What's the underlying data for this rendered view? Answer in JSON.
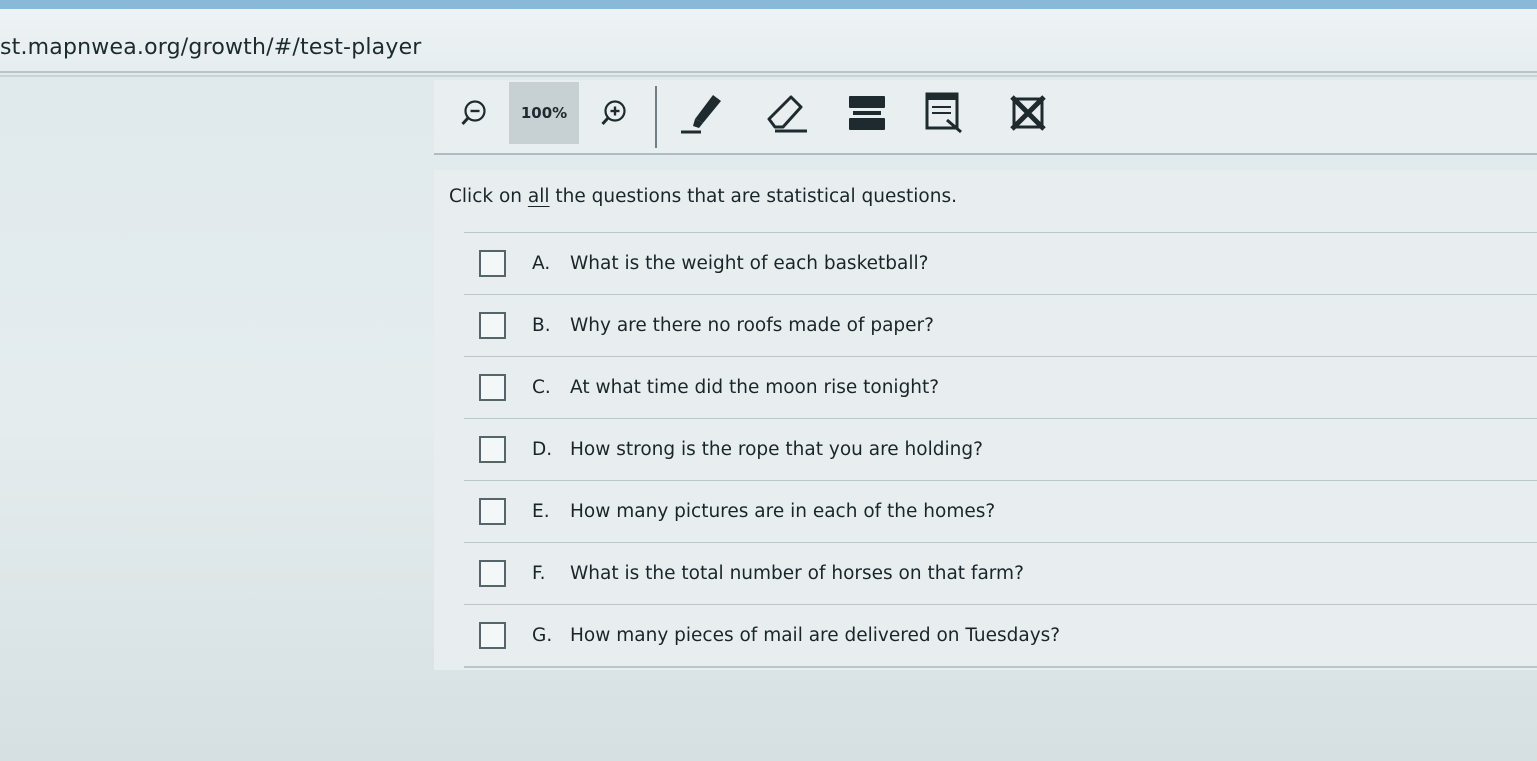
{
  "browser": {
    "url": "st.mapnwea.org/growth/#/test-player"
  },
  "toolbar": {
    "zoom_out_icon": "zoom-out-icon",
    "zoom_level": "100%",
    "zoom_in_icon": "zoom-in-icon",
    "tools": [
      "highlighter-icon",
      "eraser-icon",
      "line-reader-icon",
      "notepad-icon",
      "answer-eliminator-icon"
    ]
  },
  "question": {
    "prompt_before": "Click on ",
    "prompt_emphasis": "all",
    "prompt_after": " the questions that are statistical questions.",
    "choices": [
      {
        "letter": "A.",
        "text": "What is the weight of each basketball?"
      },
      {
        "letter": "B.",
        "text": "Why are there no roofs made of paper?"
      },
      {
        "letter": "C.",
        "text": "At what time did the moon rise tonight?"
      },
      {
        "letter": "D.",
        "text": "How strong is the rope that you are holding?"
      },
      {
        "letter": "E.",
        "text": "How many pictures are in each of the homes?"
      },
      {
        "letter": "F.",
        "text": "What is the total number of horses on that farm?"
      },
      {
        "letter": "G.",
        "text": "How many pieces of mail are delivered on Tuesdays?"
      }
    ]
  },
  "colors": {
    "page_background": "#e4ecee",
    "text": "#1b2529",
    "accent_top": "#8ab8d9"
  }
}
